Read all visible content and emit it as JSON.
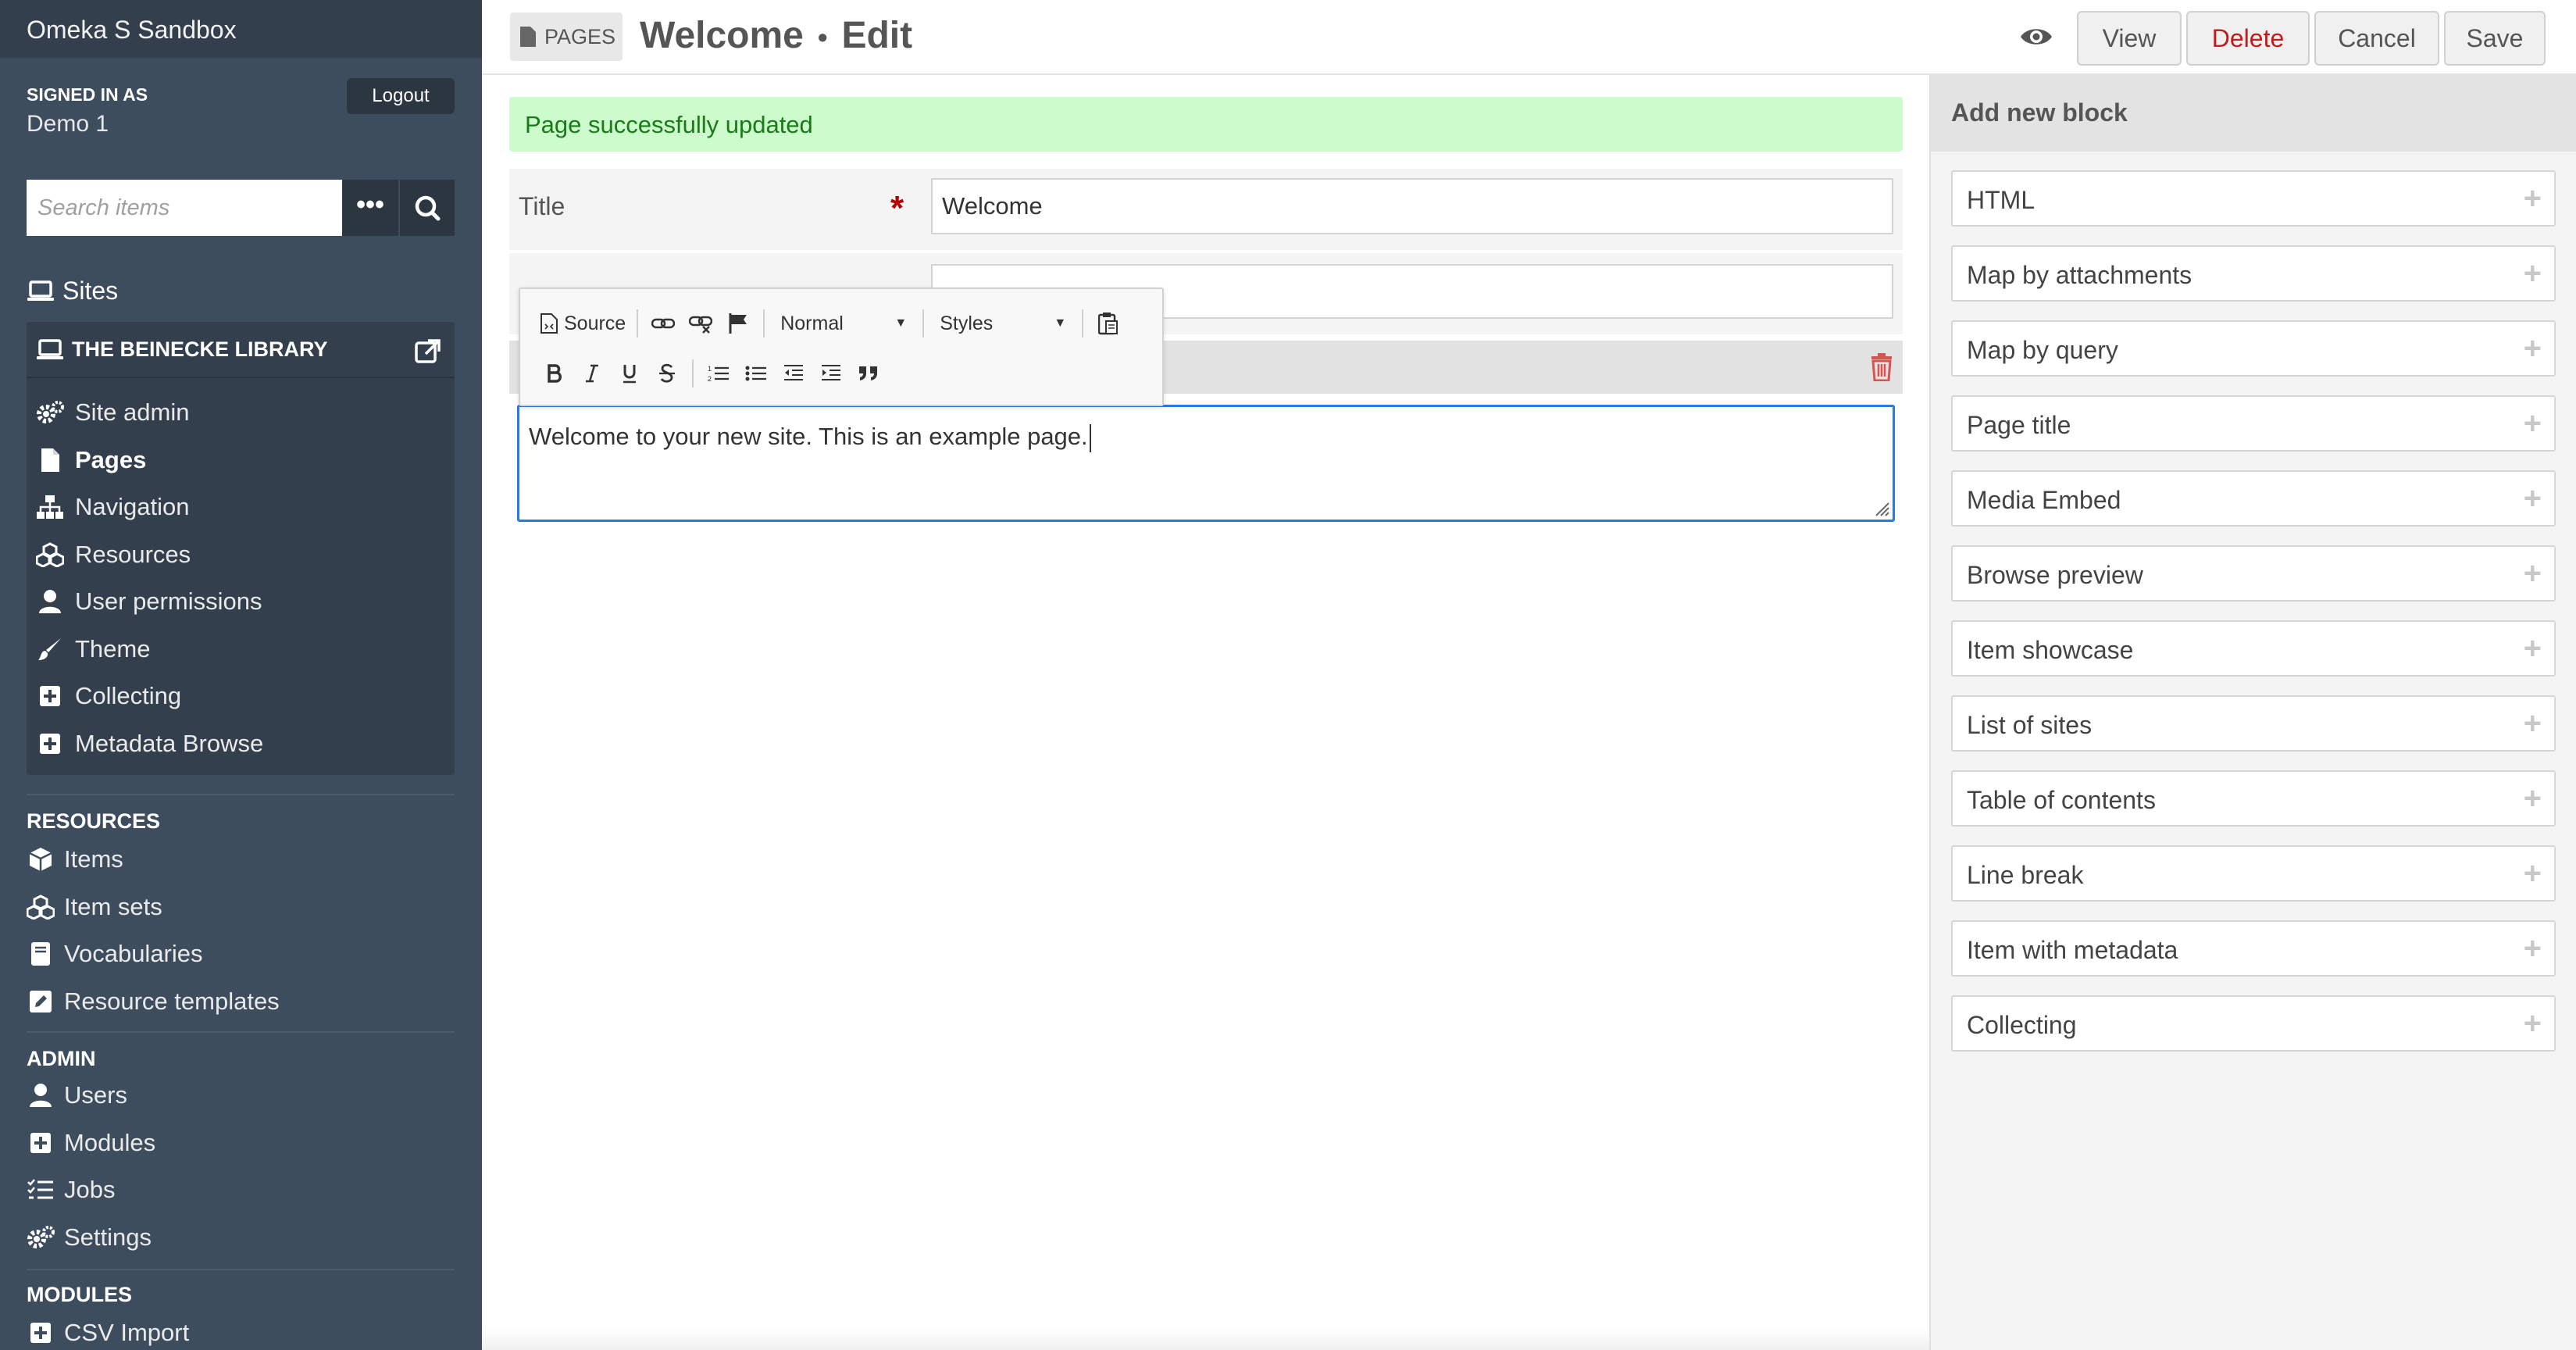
{
  "app": {
    "title": "Omeka S Sandbox"
  },
  "user": {
    "signed_in_label": "SIGNED IN AS",
    "name": "Demo 1",
    "logout_label": "Logout"
  },
  "search": {
    "placeholder": "Search items",
    "more_label": "•••"
  },
  "sites": {
    "heading": "Sites",
    "current_site": "THE BEINECKE LIBRARY",
    "menu": [
      {
        "label": "Site admin",
        "icon": "cogs-icon"
      },
      {
        "label": "Pages",
        "icon": "file-icon",
        "active": true
      },
      {
        "label": "Navigation",
        "icon": "sitemap-icon"
      },
      {
        "label": "Resources",
        "icon": "cubes-icon"
      },
      {
        "label": "User permissions",
        "icon": "user-icon"
      },
      {
        "label": "Theme",
        "icon": "brush-icon"
      },
      {
        "label": "Collecting",
        "icon": "plus-square-icon"
      },
      {
        "label": "Metadata Browse",
        "icon": "plus-square-icon"
      }
    ]
  },
  "resources": {
    "heading": "RESOURCES",
    "items": [
      {
        "label": "Items",
        "icon": "cube-icon"
      },
      {
        "label": "Item sets",
        "icon": "cubes-icon"
      },
      {
        "label": "Vocabularies",
        "icon": "book-icon"
      },
      {
        "label": "Resource templates",
        "icon": "edit-icon"
      }
    ]
  },
  "admin": {
    "heading": "ADMIN",
    "items": [
      {
        "label": "Users",
        "icon": "user-icon"
      },
      {
        "label": "Modules",
        "icon": "plus-square-icon"
      },
      {
        "label": "Jobs",
        "icon": "tasks-icon"
      },
      {
        "label": "Settings",
        "icon": "cogs-icon"
      }
    ]
  },
  "modules": {
    "heading": "MODULES",
    "items": [
      {
        "label": "CSV Import",
        "icon": "plus-square-icon"
      }
    ]
  },
  "header": {
    "breadcrumb": "PAGES",
    "title": "Welcome",
    "separator": "•",
    "mode": "Edit",
    "buttons": {
      "view": "View",
      "delete": "Delete",
      "cancel": "Cancel",
      "save": "Save"
    }
  },
  "form": {
    "success_message": "Page successfully updated",
    "title_label": "Title",
    "title_value": "Welcome",
    "required_mark": "*",
    "editor_text": "Welcome to your new site. This is an example page."
  },
  "editor_toolbar": {
    "source_label": "Source",
    "format_value": "Normal",
    "styles_value": "Styles"
  },
  "add_block": {
    "heading": "Add new block",
    "plus": "+",
    "blocks": [
      "HTML",
      "Map by attachments",
      "Map by query",
      "Page title",
      "Media Embed",
      "Browse preview",
      "Item showcase",
      "List of sites",
      "Table of contents",
      "Line break",
      "Item with metadata",
      "Collecting"
    ]
  },
  "colors": {
    "sidebar_bg": "#3e4d5e",
    "success_bg": "#ccfccc",
    "success_text": "#1a7a1a",
    "delete_text": "#c41a1a",
    "required": "#b00000",
    "focus": "#2a7ae4"
  }
}
